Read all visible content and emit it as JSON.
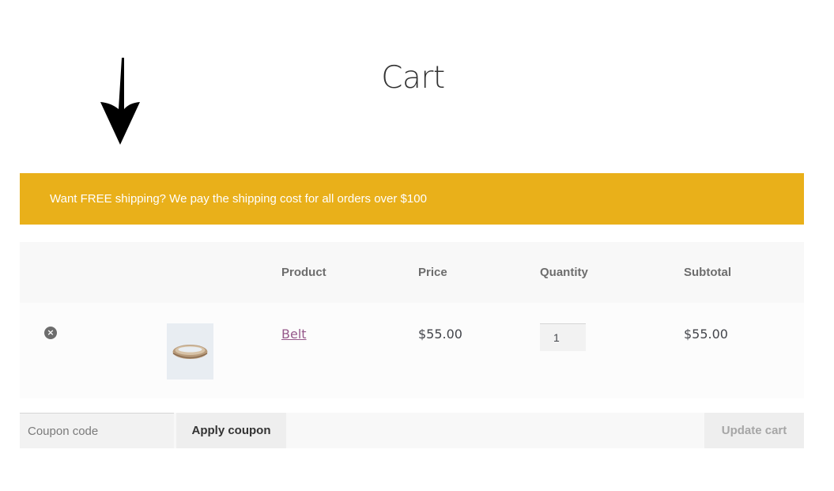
{
  "page": {
    "title": "Cart"
  },
  "notice": {
    "text": "Want FREE shipping? We pay the shipping cost for all orders over $100",
    "color": "#e9b01a"
  },
  "cart": {
    "headers": {
      "product": "Product",
      "price": "Price",
      "quantity": "Quantity",
      "subtotal": "Subtotal"
    },
    "items": [
      {
        "name": "Belt",
        "price": "$55.00",
        "quantity": "1",
        "subtotal": "$55.00",
        "remove_icon": "×"
      }
    ]
  },
  "actions": {
    "coupon_placeholder": "Coupon code",
    "apply_label": "Apply coupon",
    "update_label": "Update cart"
  },
  "colors": {
    "link": "#96588a",
    "header_text": "#6d6d6d"
  }
}
